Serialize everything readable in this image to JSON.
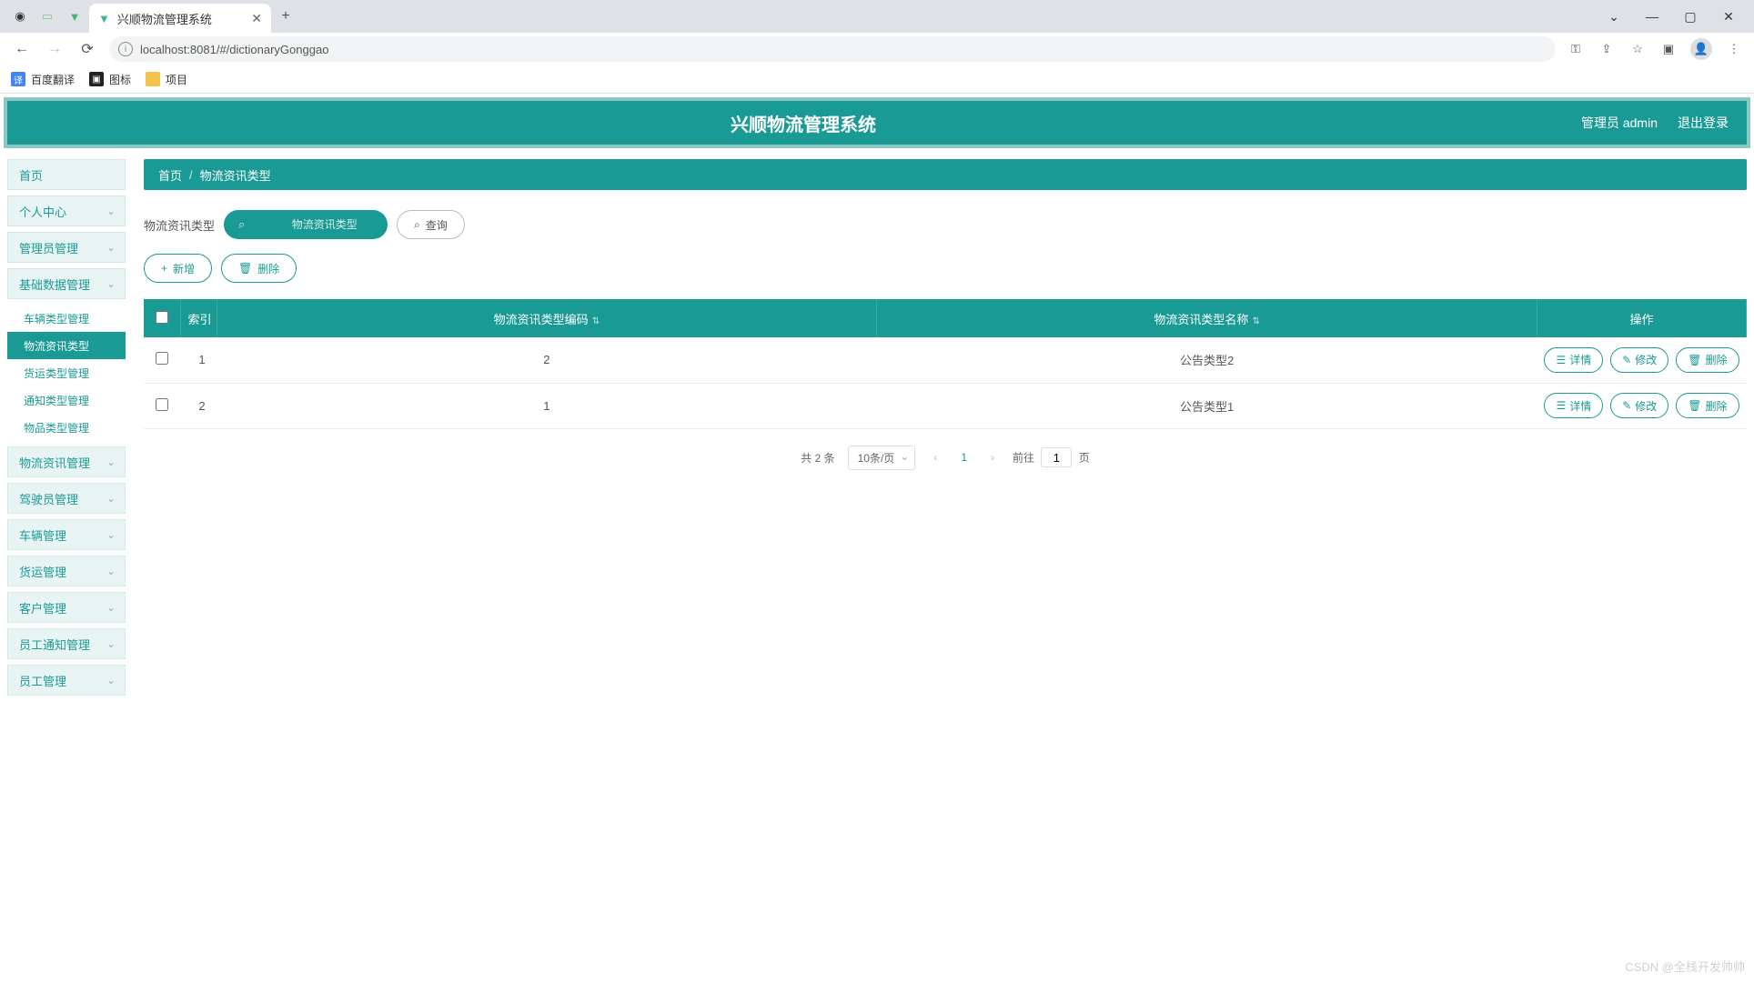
{
  "browser": {
    "tab_title": "兴顺物流管理系统",
    "url": "localhost:8081/#/dictionaryGonggao",
    "win_min": "―",
    "win_chev": "⌄",
    "win_max": "▢",
    "win_close": "✕",
    "add_tab": "+",
    "back": "←",
    "forward": "→",
    "reload": "⟳",
    "key_icon": "⚿",
    "share_icon": "⇪",
    "star_icon": "☆",
    "ext_icon": "▣",
    "menu_icon": "⋮"
  },
  "bookmarks": [
    {
      "label": "百度翻译",
      "color": "#4285f4",
      "glyph": "译"
    },
    {
      "label": "图标",
      "color": "#222",
      "glyph": "▣"
    },
    {
      "label": "项目",
      "color": "#f5c24b",
      "glyph": ""
    }
  ],
  "header": {
    "title": "兴顺物流管理系统",
    "user_label": "管理员 admin",
    "logout": "退出登录"
  },
  "sidebar": {
    "home": "首页",
    "items": [
      {
        "label": "个人中心"
      },
      {
        "label": "管理员管理"
      },
      {
        "label": "基础数据管理",
        "expanded": true,
        "subs": [
          {
            "label": "车辆类型管理"
          },
          {
            "label": "物流资讯类型",
            "active": true
          },
          {
            "label": "货运类型管理"
          },
          {
            "label": "通知类型管理"
          },
          {
            "label": "物品类型管理"
          }
        ]
      },
      {
        "label": "物流资讯管理"
      },
      {
        "label": "驾驶员管理"
      },
      {
        "label": "车辆管理"
      },
      {
        "label": "货运管理"
      },
      {
        "label": "客户管理"
      },
      {
        "label": "员工通知管理"
      },
      {
        "label": "员工管理"
      }
    ]
  },
  "breadcrumb": {
    "home": "首页",
    "sep": "/",
    "current": "物流资讯类型"
  },
  "filter": {
    "label": "物流资讯类型",
    "placeholder": "物流资讯类型",
    "query_btn": "查询"
  },
  "actions": {
    "add": "新增",
    "del": "删除",
    "plus": "+",
    "trash": "🗑"
  },
  "table": {
    "cols": {
      "idx": "索引",
      "code": "物流资讯类型编码",
      "name": "物流资讯类型名称",
      "ops": "操作"
    },
    "rows": [
      {
        "idx": "1",
        "code": "2",
        "name": "公告类型2"
      },
      {
        "idx": "2",
        "code": "1",
        "name": "公告类型1"
      }
    ],
    "row_actions": {
      "detail": "详情",
      "edit": "修改",
      "del": "删除",
      "detail_icon": "☰",
      "edit_icon": "✎",
      "del_icon": "🗑"
    }
  },
  "pagination": {
    "total_text": "共 2 条",
    "per_page": "10条/页",
    "current": "1",
    "goto_prefix": "前往",
    "goto_value": "1",
    "goto_suffix": "页",
    "prev": "‹",
    "next": "›"
  },
  "watermark": "CSDN @全栈开发帅帅"
}
